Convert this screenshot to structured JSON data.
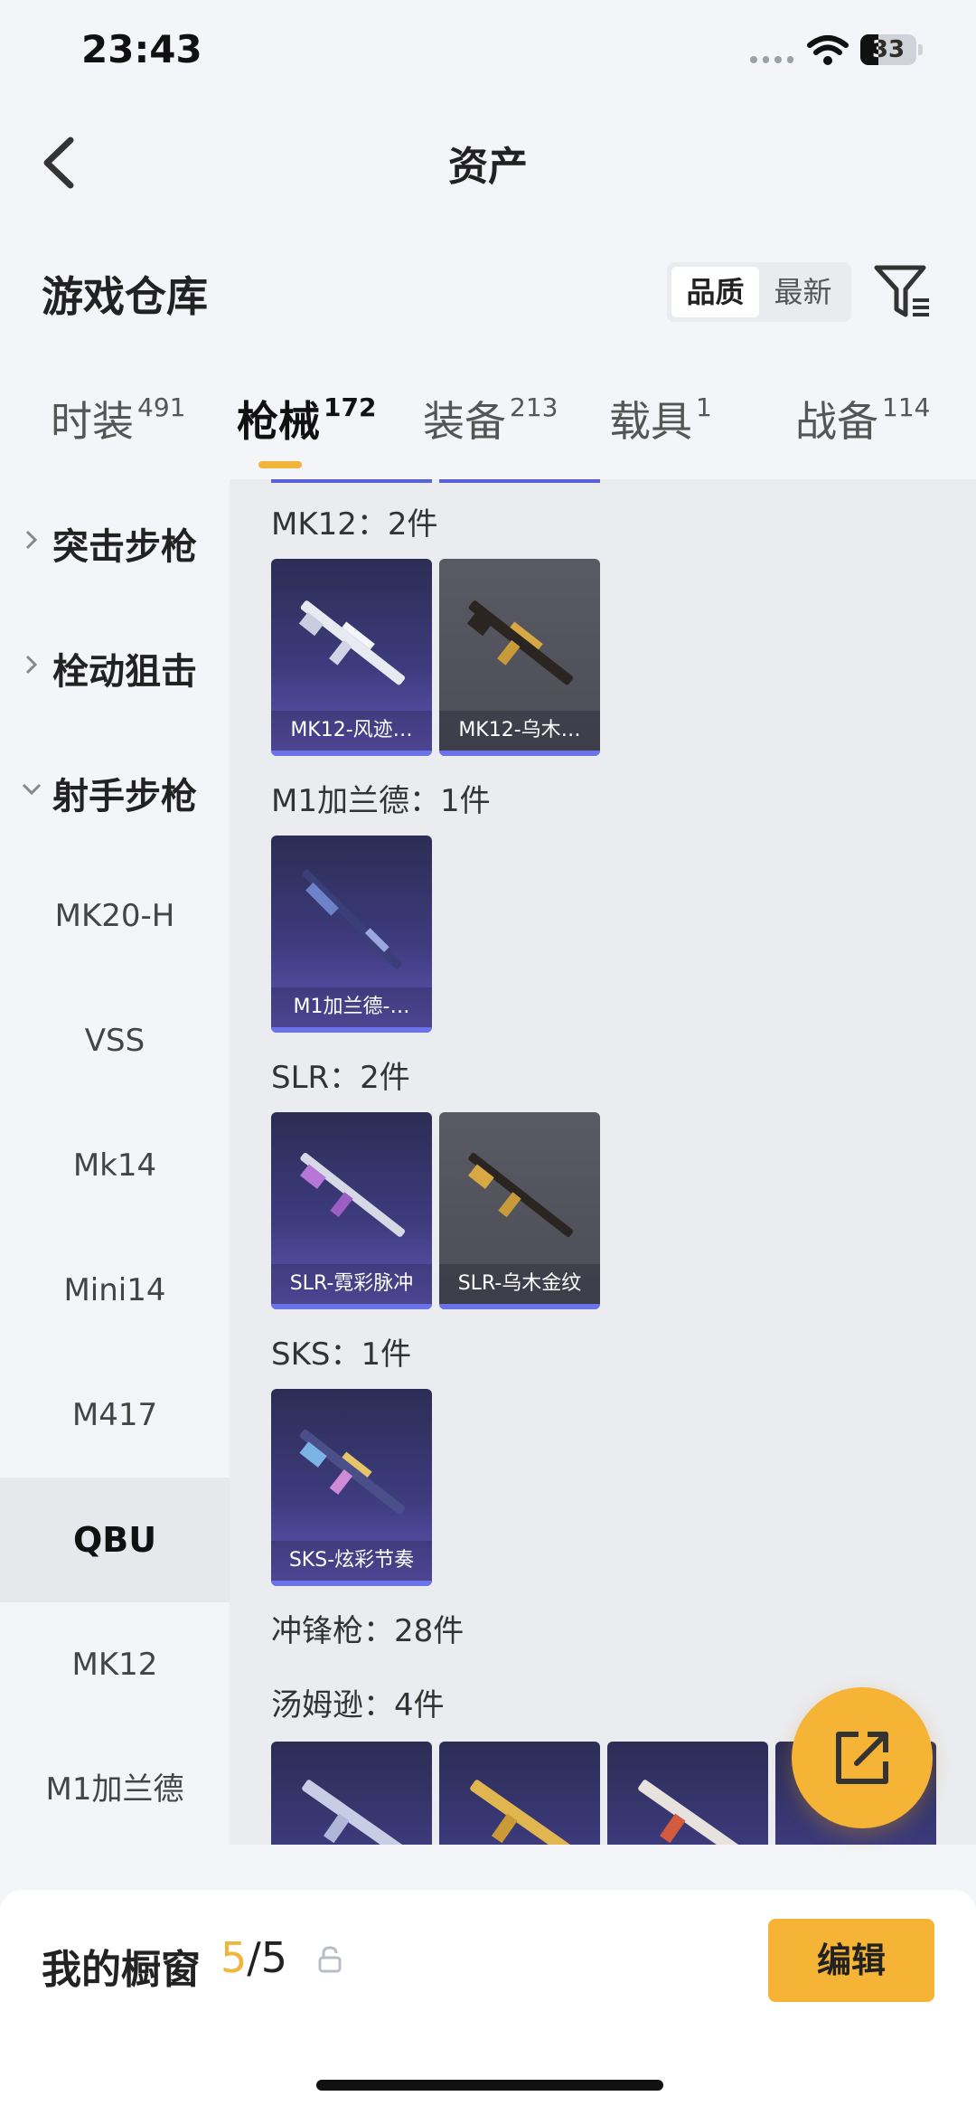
{
  "status_bar": {
    "time": "23:43",
    "battery": "33",
    "battery_level": 0.33
  },
  "header": {
    "title": "资产"
  },
  "warehouse": {
    "title": "游戏仓库",
    "sort_options": [
      "品质",
      "最新"
    ],
    "sort_selected": "品质"
  },
  "tabs": [
    {
      "label": "时装",
      "count": "491"
    },
    {
      "label": "枪械",
      "count": "172",
      "active": true
    },
    {
      "label": "装备",
      "count": "213"
    },
    {
      "label": "载具",
      "count": "1"
    },
    {
      "label": "战备",
      "count": "114"
    }
  ],
  "sidebar": {
    "categories": [
      {
        "label": "突击步枪",
        "expanded": false
      },
      {
        "label": "栓动狙击",
        "expanded": false
      },
      {
        "label": "射手步枪",
        "expanded": true
      }
    ],
    "subitems": [
      "MK20-H",
      "VSS",
      "Mk14",
      "Mini14",
      "M417",
      "QBU",
      "MK12",
      "M1加兰德"
    ],
    "selected": "QBU"
  },
  "groups": [
    {
      "title": "MK12：2件",
      "items": [
        {
          "caption": "MK12-风迹…",
          "style": "purple"
        },
        {
          "caption": "MK12-乌木…",
          "style": "gray"
        }
      ]
    },
    {
      "title": "M1加兰德：1件",
      "items": [
        {
          "caption": "M1加兰德-…",
          "style": "purple"
        }
      ]
    },
    {
      "title": "SLR：2件",
      "items": [
        {
          "caption": "SLR-霓彩脉冲",
          "style": "purple"
        },
        {
          "caption": "SLR-乌木金纹",
          "style": "gray"
        }
      ]
    },
    {
      "title": "SKS：1件",
      "items": [
        {
          "caption": "SKS-炫彩节奏",
          "style": "purple"
        }
      ]
    }
  ],
  "category_smg": {
    "title": "冲锋枪：28件"
  },
  "group_thompson": {
    "title": "汤姆逊：4件"
  },
  "showcase": {
    "label": "我的橱窗",
    "current": "5",
    "total": "/5",
    "edit_label": "编辑"
  },
  "colors": {
    "accent": "#f5b436",
    "card_purple": "#3d3b7d",
    "card_gray": "#4c4c56"
  }
}
